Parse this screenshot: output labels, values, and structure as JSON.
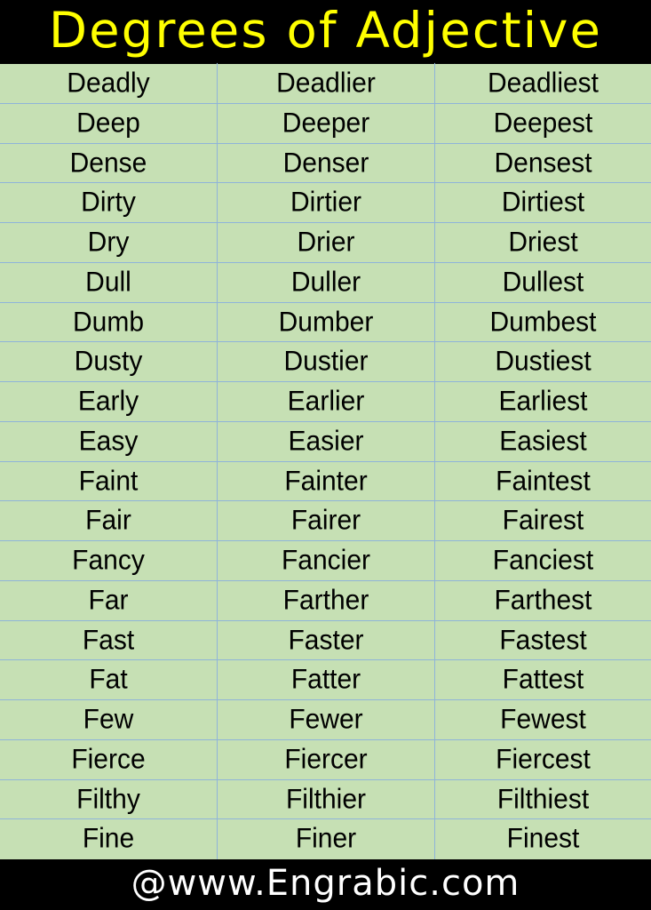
{
  "title": "Degrees of Adjective",
  "colors": {
    "title_text": "#ffff00",
    "header_bg": "#000000",
    "table_bg": "#c6e0b4",
    "grid_lines": "#8fb4d9",
    "footer_text": "#ffffff"
  },
  "rows": [
    [
      "Deadly",
      "Deadlier",
      "Deadliest"
    ],
    [
      "Deep",
      "Deeper",
      "Deepest"
    ],
    [
      "Dense",
      "Denser",
      "Densest"
    ],
    [
      "Dirty",
      "Dirtier",
      "Dirtiest"
    ],
    [
      "Dry",
      "Drier",
      "Driest"
    ],
    [
      "Dull",
      "Duller",
      "Dullest"
    ],
    [
      "Dumb",
      "Dumber",
      "Dumbest"
    ],
    [
      "Dusty",
      "Dustier",
      "Dustiest"
    ],
    [
      "Early",
      "Earlier",
      "Earliest"
    ],
    [
      "Easy",
      "Easier",
      "Easiest"
    ],
    [
      "Faint",
      "Fainter",
      "Faintest"
    ],
    [
      "Fair",
      "Fairer",
      "Fairest"
    ],
    [
      "Fancy",
      "Fancier",
      "Fanciest"
    ],
    [
      "Far",
      "Farther",
      "Farthest"
    ],
    [
      "Fast",
      "Faster",
      "Fastest"
    ],
    [
      "Fat",
      "Fatter",
      "Fattest"
    ],
    [
      "Few",
      "Fewer",
      "Fewest"
    ],
    [
      "Fierce",
      "Fiercer",
      "Fiercest"
    ],
    [
      "Filthy",
      "Filthier",
      "Filthiest"
    ],
    [
      "Fine",
      "Finer",
      "Finest"
    ]
  ],
  "footer": "@www.Engrabic.com"
}
